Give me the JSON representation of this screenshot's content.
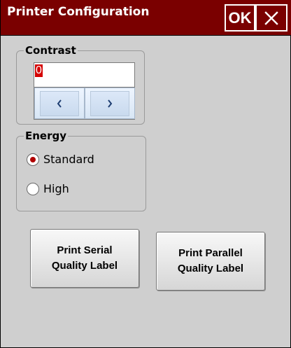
{
  "window": {
    "title": "Printer Configuration",
    "ok_label": "OK",
    "close_icon": "close-icon",
    "title_bar_color": "#7a0000",
    "background_color": "#cfcfcf"
  },
  "contrast": {
    "label": "Contrast",
    "value": "0",
    "left_icon": "chevron-left-icon",
    "right_icon": "chevron-right-icon"
  },
  "energy": {
    "label": "Energy",
    "options": [
      {
        "label": "Standard",
        "selected": true
      },
      {
        "label": "High",
        "selected": false
      }
    ]
  },
  "actions": {
    "serial_line1": "Print Serial",
    "serial_line2": "Quality Label",
    "parallel_line1": "Print Parallel",
    "parallel_line2": "Quality Label"
  }
}
